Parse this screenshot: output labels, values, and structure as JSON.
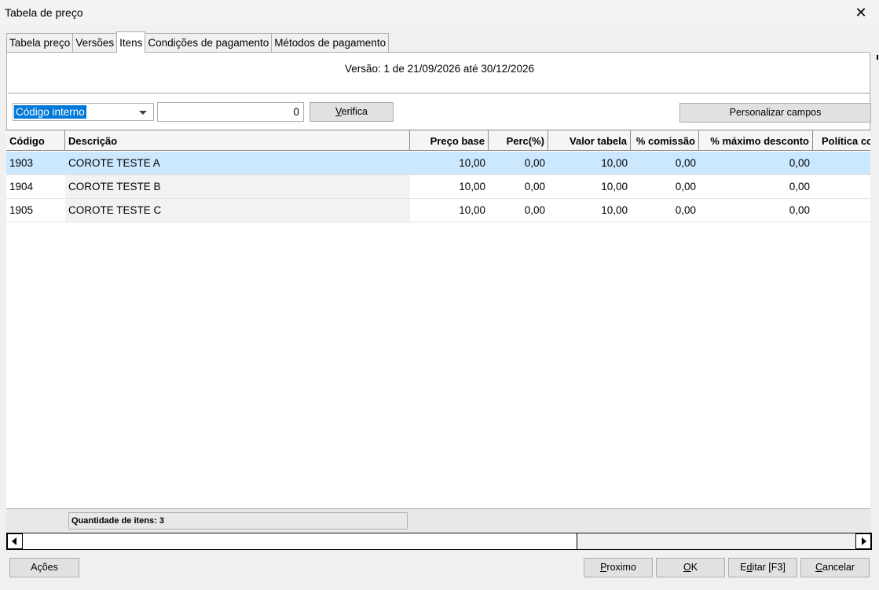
{
  "window": {
    "title": "Tabela de preço"
  },
  "tabs": [
    {
      "label": "Tabela preço",
      "active": false
    },
    {
      "label": "Versões",
      "active": false
    },
    {
      "label": "Itens",
      "active": true
    },
    {
      "label": "Condições de pagamento",
      "active": false
    },
    {
      "label": "Métodos de pagamento",
      "active": false
    }
  ],
  "version_info": "Versão: 1 de 21/09/2026 até 30/12/2026",
  "search": {
    "field_selected": "Código interno",
    "code_value": "0",
    "verify_label_key": "V",
    "verify_label_rest": "erifica",
    "customize_label": "Personalizar campos"
  },
  "grid": {
    "columns": [
      "Código",
      "Descrição",
      "Preço base",
      "Perc(%)",
      "Valor tabela",
      "% comissão",
      "% máximo desconto",
      "Política co"
    ],
    "rows": [
      {
        "codigo": "1903",
        "descricao": "COROTE TESTE A",
        "preco_base": "10,00",
        "perc": "0,00",
        "valor_tabela": "10,00",
        "comissao": "0,00",
        "max_desconto": "0,00",
        "politica": ""
      },
      {
        "codigo": "1904",
        "descricao": "COROTE TESTE B",
        "preco_base": "10,00",
        "perc": "0,00",
        "valor_tabela": "10,00",
        "comissao": "0,00",
        "max_desconto": "0,00",
        "politica": ""
      },
      {
        "codigo": "1905",
        "descricao": "COROTE TESTE C",
        "preco_base": "10,00",
        "perc": "0,00",
        "valor_tabela": "10,00",
        "comissao": "0,00",
        "max_desconto": "0,00",
        "politica": ""
      }
    ],
    "selected_row": 0,
    "summary": "Quantidade de itens: 3"
  },
  "actions": {
    "acoes": "Ações",
    "proximo_key": "P",
    "proximo_rest": "roximo",
    "ok_key": "O",
    "ok_rest": "K",
    "editar_pre": "E",
    "editar_key": "d",
    "editar_rest": "itar [F3]",
    "cancelar_key": "C",
    "cancelar_rest": "ancelar"
  },
  "colors": {
    "selection": "#cce8ff",
    "highlight": "#0078d7",
    "window_bg": "#f0f0f0"
  },
  "icons": [
    "close-icon",
    "chevron-down-icon",
    "arrow-left-icon",
    "arrow-right-icon"
  ]
}
